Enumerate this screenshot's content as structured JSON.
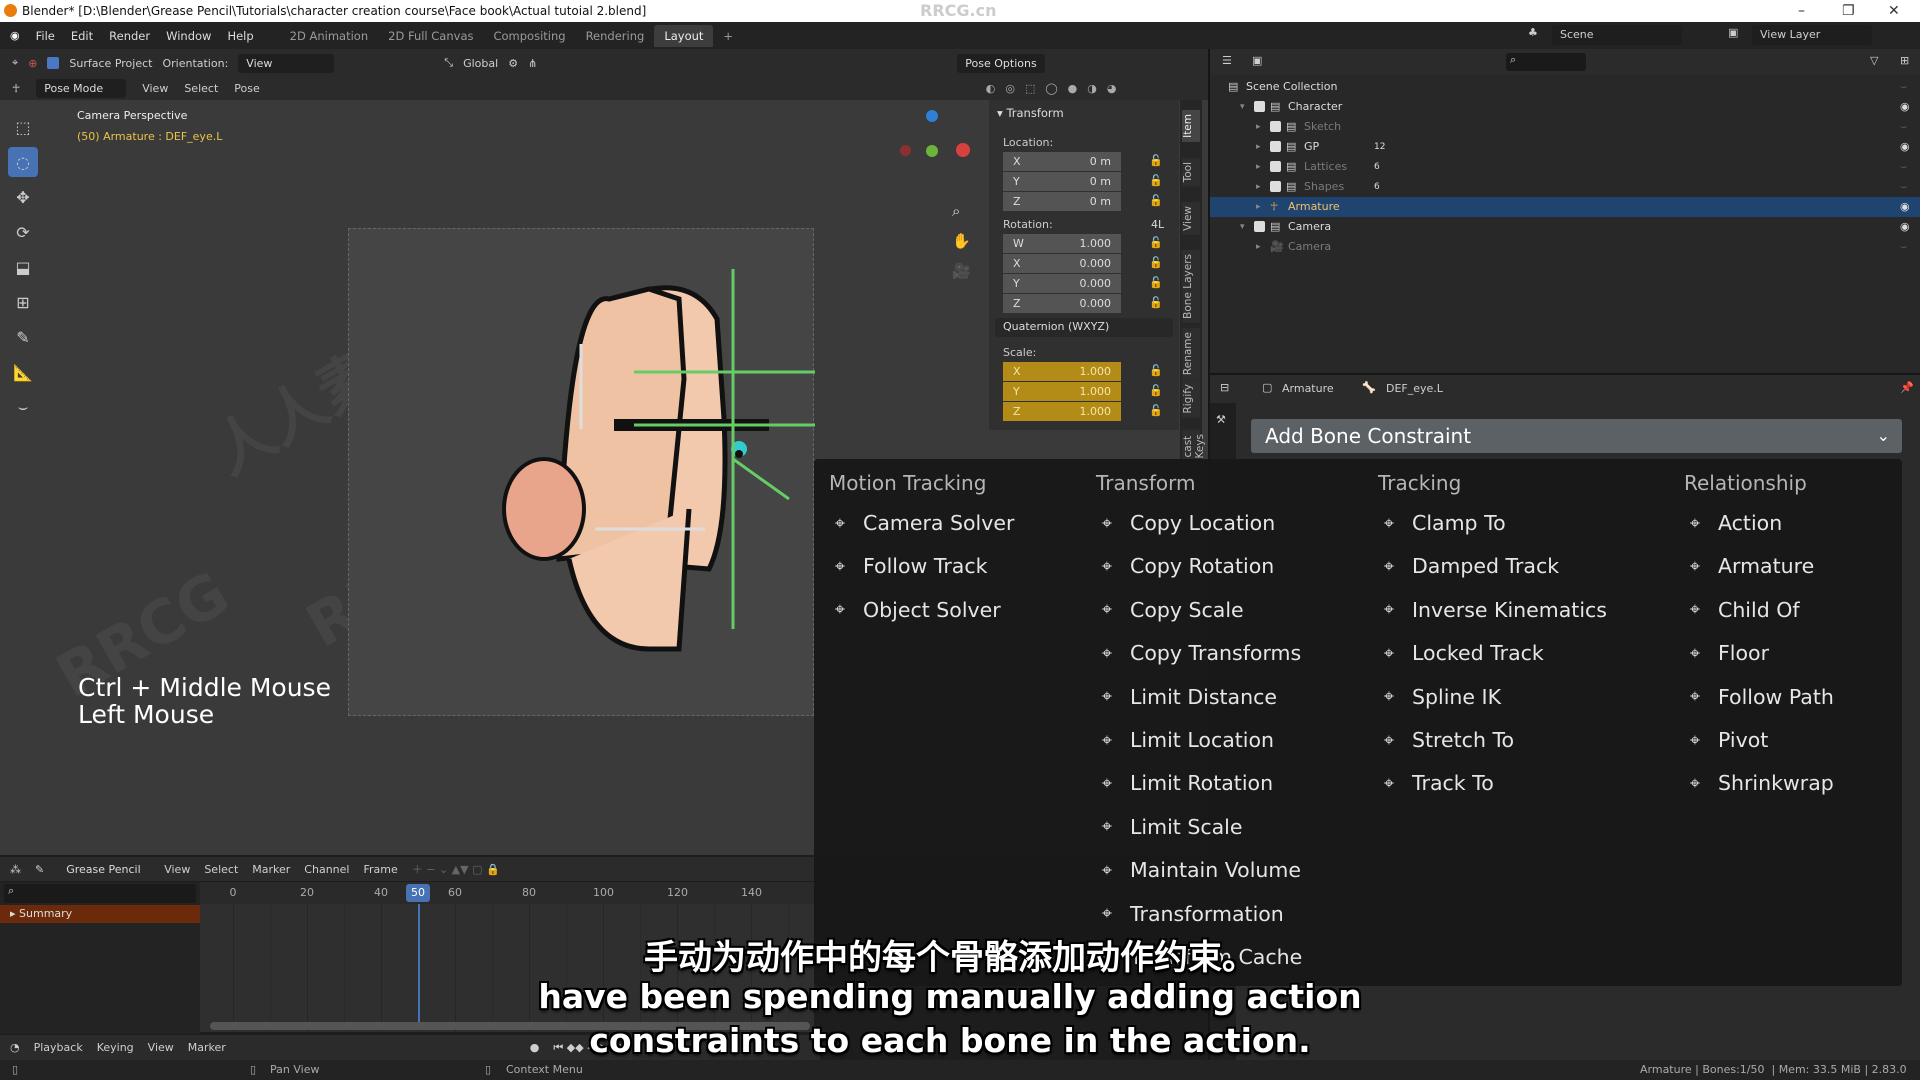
{
  "window": {
    "title": "Blender* [D:\\Blender\\Grease Pencil\\Tutorials\\character creation course\\Face book\\Actual tutoial 2.blend]",
    "watermark": "RRCG.cn"
  },
  "menubar": {
    "items": [
      "File",
      "Edit",
      "Render",
      "Window",
      "Help"
    ],
    "workspaces": [
      "2D Animation",
      "2D Full Canvas",
      "Compositing",
      "Rendering",
      "Layout"
    ],
    "active_workspace": "Layout",
    "add": "+",
    "scene": "Scene",
    "view_layer": "View Layer"
  },
  "toolheader": {
    "surface_project": "Surface Project",
    "orientation_label": "Orientation:",
    "orientation_value": "View",
    "transform_orientation": "Global",
    "pose_options": "Pose Options"
  },
  "viewheader": {
    "mode": "Pose Mode",
    "menus": [
      "View",
      "Select",
      "Pose"
    ]
  },
  "viewport": {
    "camera_label": "Camera Perspective",
    "object_label": "(50) Armature : DEF_eye.L",
    "shortcut_line1": "Ctrl + Middle Mouse",
    "shortcut_line2": "Left Mouse"
  },
  "npanel": {
    "section": "Transform",
    "location_label": "Location:",
    "location": [
      {
        "axis": "X",
        "value": "0 m"
      },
      {
        "axis": "Y",
        "value": "0 m"
      },
      {
        "axis": "Z",
        "value": "0 m"
      }
    ],
    "rotation_label": "Rotation:",
    "rotation_lock": "4L",
    "rotation": [
      {
        "axis": "W",
        "value": "1.000"
      },
      {
        "axis": "X",
        "value": "0.000"
      },
      {
        "axis": "Y",
        "value": "0.000"
      },
      {
        "axis": "Z",
        "value": "0.000"
      }
    ],
    "rotation_mode": "Quaternion (WXYZ)",
    "scale_label": "Scale:",
    "scale": [
      {
        "axis": "X",
        "value": "1.000"
      },
      {
        "axis": "Y",
        "value": "1.000"
      },
      {
        "axis": "Z",
        "value": "1.000"
      }
    ],
    "tabs": [
      "Item",
      "Tool",
      "View",
      "Bone Layers",
      "Rename",
      "Rigify",
      "cast Keys"
    ]
  },
  "outliner": {
    "rows": [
      {
        "label": "Scene Collection",
        "indent": 0,
        "checkbox": false,
        "dim": false
      },
      {
        "label": "Character",
        "indent": 1,
        "checkbox": true,
        "dim": false,
        "eye": true
      },
      {
        "label": "Sketch",
        "indent": 2,
        "checkbox": true,
        "dim": true,
        "badge": ""
      },
      {
        "label": "GP",
        "indent": 2,
        "checkbox": true,
        "dim": false,
        "badge": "12",
        "eye": true
      },
      {
        "label": "Lattices",
        "indent": 2,
        "checkbox": true,
        "dim": true,
        "badge": "6"
      },
      {
        "label": "Shapes",
        "indent": 2,
        "checkbox": true,
        "dim": true,
        "badge": "6"
      },
      {
        "label": "Armature",
        "indent": 2,
        "checkbox": false,
        "dim": false,
        "selected": true,
        "eye": true
      },
      {
        "label": "Camera",
        "indent": 1,
        "checkbox": true,
        "dim": false,
        "eye": true
      },
      {
        "label": "Camera",
        "indent": 2,
        "checkbox": false,
        "dim": true
      }
    ]
  },
  "properties": {
    "breadcrumb_object": "Armature",
    "breadcrumb_bone": "DEF_eye.L",
    "add_constraint": "Add Bone Constraint"
  },
  "constraint_menu": {
    "columns": [
      {
        "title": "Motion Tracking",
        "items": [
          {
            "label": "Camera Solver",
            "icon": "camera-solver-icon"
          },
          {
            "label": "Follow Track",
            "icon": "follow-track-icon"
          },
          {
            "label": "Object Solver",
            "icon": "object-solver-icon"
          }
        ]
      },
      {
        "title": "Transform",
        "items": [
          {
            "label": "Copy Location",
            "icon": "copy-location-icon"
          },
          {
            "label": "Copy Rotation",
            "icon": "copy-rotation-icon"
          },
          {
            "label": "Copy Scale",
            "icon": "copy-scale-icon"
          },
          {
            "label": "Copy Transforms",
            "icon": "copy-transforms-icon"
          },
          {
            "label": "Limit Distance",
            "icon": "limit-distance-icon"
          },
          {
            "label": "Limit Location",
            "icon": "limit-location-icon"
          },
          {
            "label": "Limit Rotation",
            "icon": "limit-rotation-icon"
          },
          {
            "label": "Limit Scale",
            "icon": "limit-scale-icon"
          },
          {
            "label": "Maintain Volume",
            "icon": "maintain-volume-icon"
          },
          {
            "label": "Transformation",
            "icon": "transformation-icon"
          },
          {
            "label": "Transform Cache",
            "icon": "transform-cache-icon"
          }
        ]
      },
      {
        "title": "Tracking",
        "items": [
          {
            "label": "Clamp To",
            "icon": "clamp-to-icon"
          },
          {
            "label": "Damped Track",
            "icon": "damped-track-icon"
          },
          {
            "label": "Inverse Kinematics",
            "icon": "ik-icon"
          },
          {
            "label": "Locked Track",
            "icon": "locked-track-icon"
          },
          {
            "label": "Spline IK",
            "icon": "spline-ik-icon"
          },
          {
            "label": "Stretch To",
            "icon": "stretch-to-icon"
          },
          {
            "label": "Track To",
            "icon": "track-to-icon"
          }
        ]
      },
      {
        "title": "Relationship",
        "items": [
          {
            "label": "Action",
            "icon": "action-icon"
          },
          {
            "label": "Armature",
            "icon": "armature-icon"
          },
          {
            "label": "Child Of",
            "icon": "child-of-icon"
          },
          {
            "label": "Floor",
            "icon": "floor-icon"
          },
          {
            "label": "Follow Path",
            "icon": "follow-path-icon"
          },
          {
            "label": "Pivot",
            "icon": "pivot-icon"
          },
          {
            "label": "Shrinkwrap",
            "icon": "shrinkwrap-icon"
          }
        ]
      }
    ]
  },
  "timeline": {
    "editor": "Grease Pencil",
    "menus": [
      "View",
      "Select",
      "Marker",
      "Channel",
      "Frame"
    ],
    "channel": "Summary",
    "ticks": [
      0,
      20,
      40,
      60,
      80,
      100,
      120,
      140
    ],
    "current_frame": 50
  },
  "playback": {
    "menus": [
      "Playback",
      "Keying",
      "View",
      "Marker"
    ]
  },
  "statusbar": {
    "pan": "Pan View",
    "context": "Context Menu",
    "stats": "Armature | Bones:1/50  | Mem: 33.5 MiB | 2.83.0"
  },
  "subtitles": {
    "zh": "手动为动作中的每个骨骼添加动作约束。",
    "en1": "have been spending manually adding action",
    "en2": "constraints to each bone in the action."
  }
}
